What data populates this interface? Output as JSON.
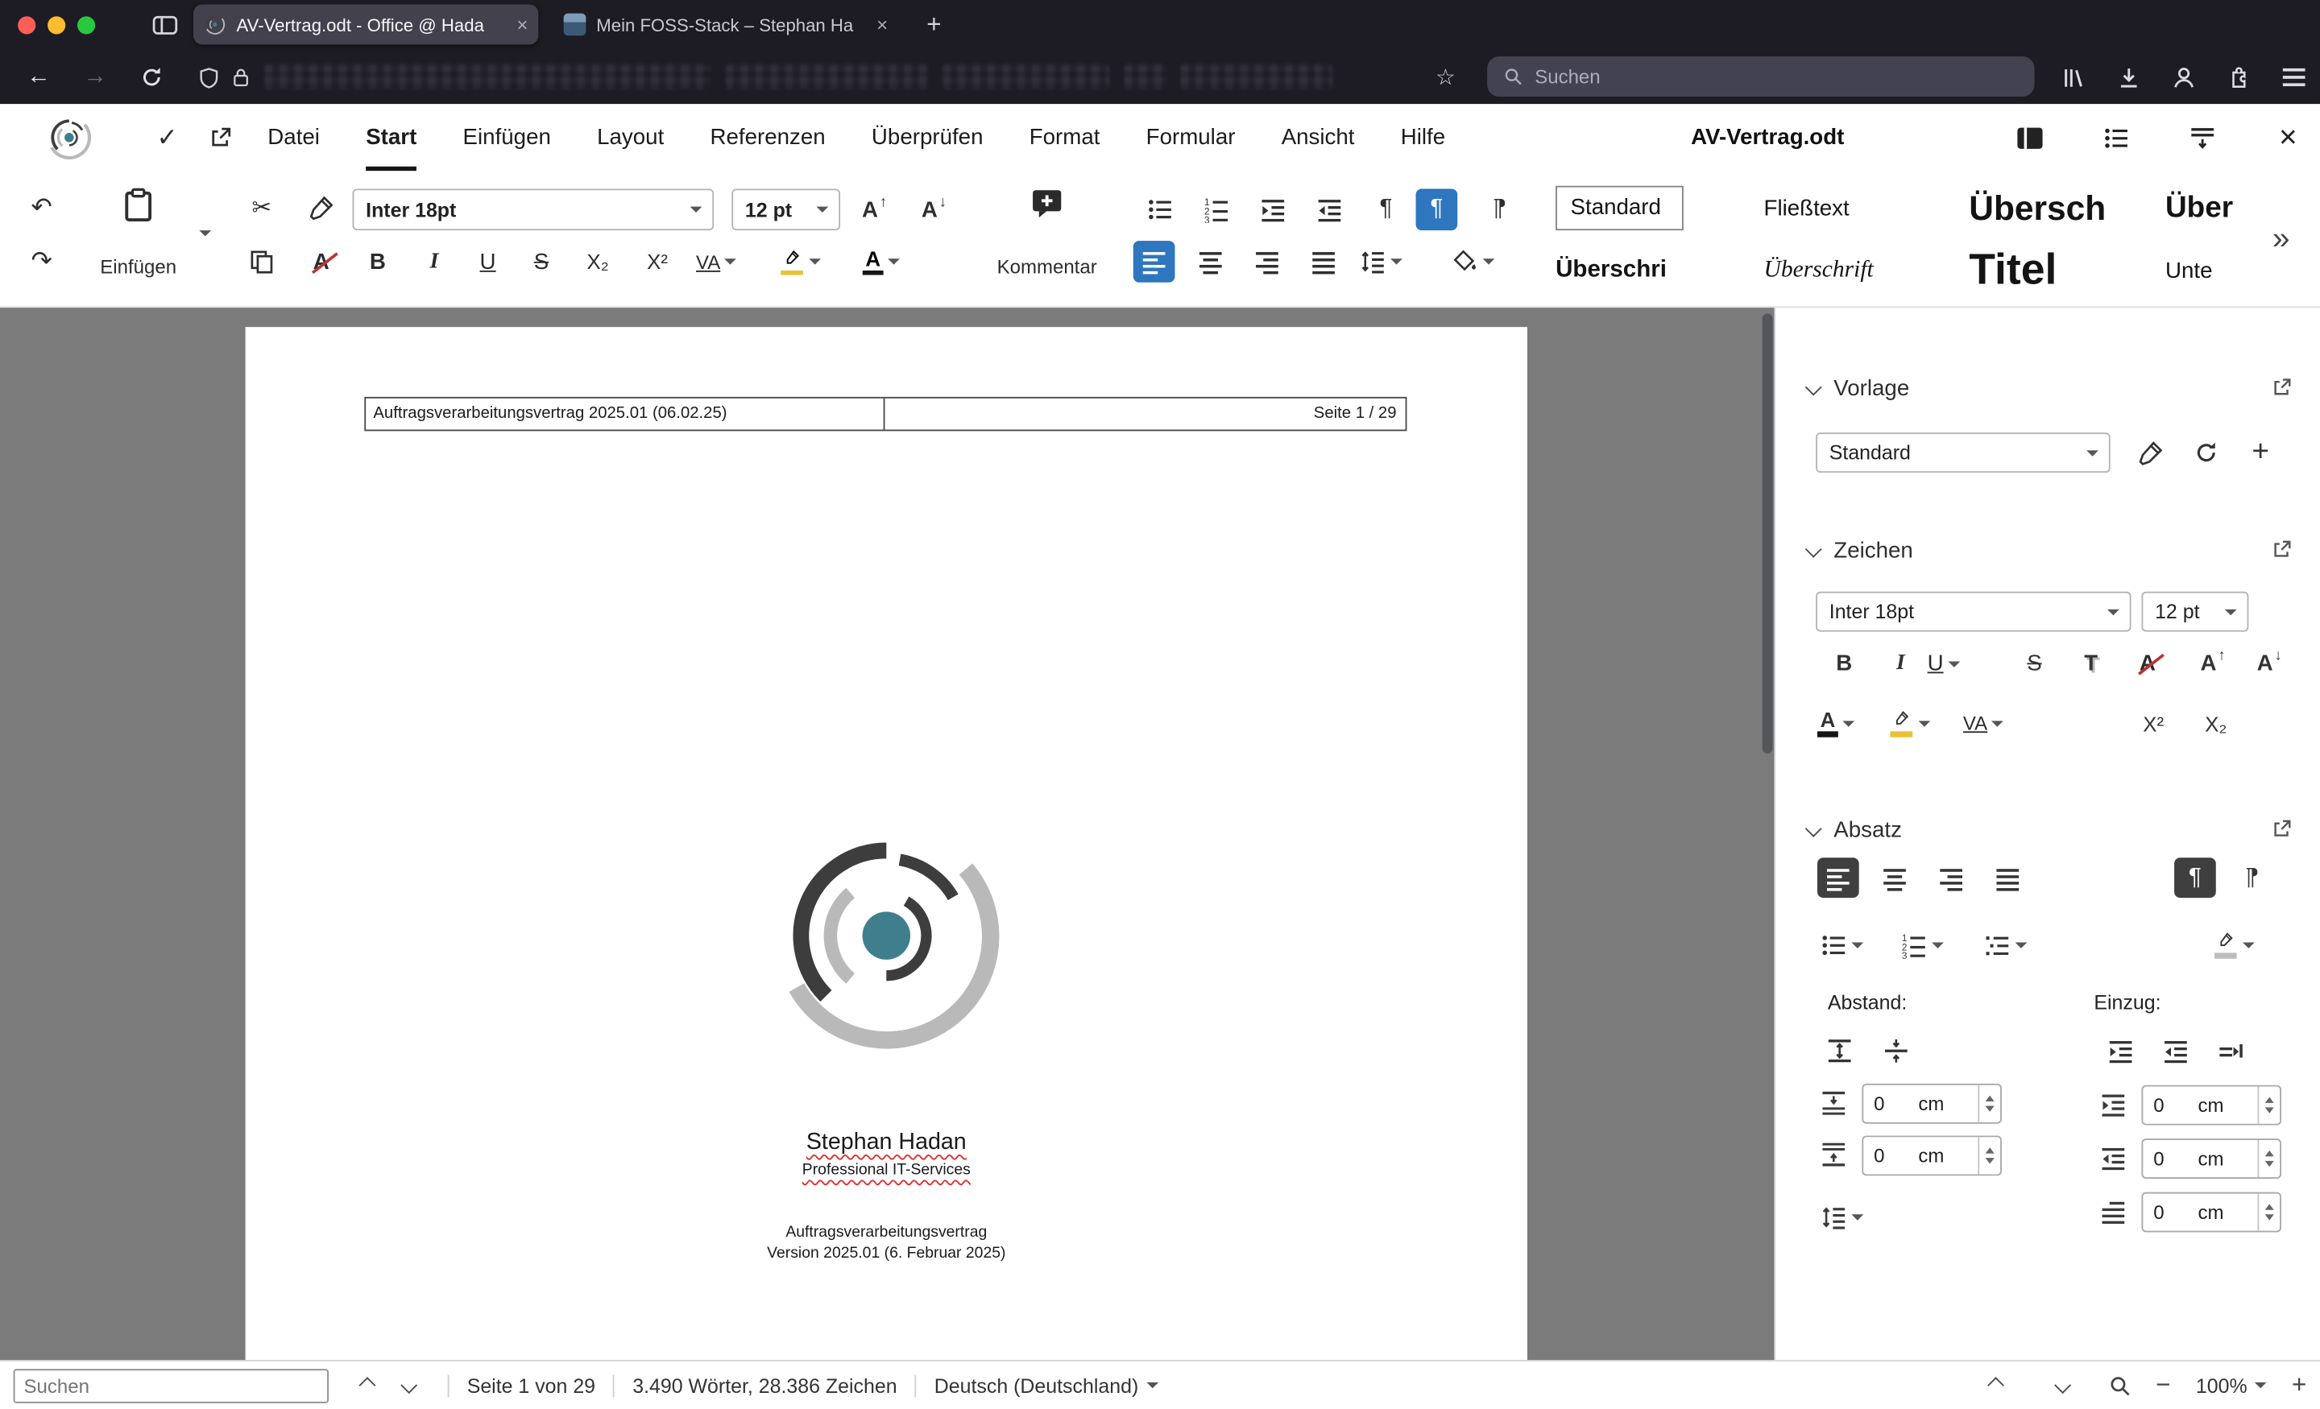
{
  "browser": {
    "tabs": [
      {
        "title": "AV-Vertrag.odt - Office @ Hada",
        "favicon": "collabora-logo",
        "active": true
      },
      {
        "title": "Mein FOSS-Stack – Stephan Ha",
        "favicon": "photo",
        "active": false
      }
    ],
    "address": {
      "search_placeholder": "Suchen"
    }
  },
  "app": {
    "menus": [
      "Datei",
      "Start",
      "Einfügen",
      "Layout",
      "Referenzen",
      "Überprüfen",
      "Format",
      "Formular",
      "Ansicht",
      "Hilfe"
    ],
    "active_menu": "Start",
    "document_title": "AV-Vertrag.odt"
  },
  "ribbon": {
    "paste_label": "Einfügen",
    "font_name": "Inter 18pt",
    "font_size": "12 pt",
    "comment_label": "Kommentar",
    "styles": [
      "Standard",
      "Fließtext",
      "Übersch",
      "Über",
      "Überschri",
      "Überschrift",
      "Titel",
      "Unte"
    ]
  },
  "document": {
    "header": {
      "left": "Auftragsverarbeitungsvertrag 2025.01 (06.02.25)",
      "right": "Seite 1 / 29"
    },
    "name": "Stephan Hadan",
    "tagline": "Professional IT-Services",
    "line1": "Auftragsverarbeitungsvertrag",
    "line2": "Version 2025.01 (6. Februar 2025)"
  },
  "sidebar": {
    "style_section": {
      "title": "Vorlage",
      "value": "Standard"
    },
    "char_section": {
      "title": "Zeichen",
      "font_name": "Inter 18pt",
      "font_size": "12 pt"
    },
    "para_section": {
      "title": "Absatz",
      "spacing_label": "Abstand:",
      "indent_label": "Einzug:",
      "spacing": [
        {
          "value": "0",
          "unit": "cm"
        },
        {
          "value": "0",
          "unit": "cm"
        }
      ],
      "indent": [
        {
          "value": "0",
          "unit": "cm"
        },
        {
          "value": "0",
          "unit": "cm"
        },
        {
          "value": "0",
          "unit": "cm"
        }
      ]
    }
  },
  "statusbar": {
    "search_placeholder": "Suchen",
    "page": "Seite 1 von 29",
    "words": "3.490 Wörter, 28.386 Zeichen",
    "language": "Deutsch (Deutschland)",
    "zoom": "100%"
  },
  "glyphs": {
    "back": "←",
    "forward": "→",
    "star": "☆",
    "new_tab": "+",
    "close_tab": "×",
    "check": "✓",
    "close": "×",
    "undo": "↶",
    "redo": "↷",
    "scissors": "✂",
    "pilcrow": "¶",
    "bold": "B",
    "italic": "I",
    "underline": "U",
    "strike": "S",
    "sub_x": "X₂",
    "sup_x": "X²",
    "spacing_va": "VA",
    "font_color_a": "A",
    "shadow": "T",
    "clear_letter": "A",
    "grow": "A",
    "arrow_up": "↑",
    "arrow_down": "↓",
    "plus": "+",
    "minus": "−",
    "gallery_more": "»"
  },
  "colors": {
    "accent_blue": "#2e76bd",
    "logo_teal": "#3f7e8d",
    "doc_background": "#7b7b7b",
    "chrome_dark": "#1d1c24",
    "traffic_red": "#ff5f57",
    "traffic_yellow": "#febc2e",
    "traffic_green": "#28c840"
  }
}
